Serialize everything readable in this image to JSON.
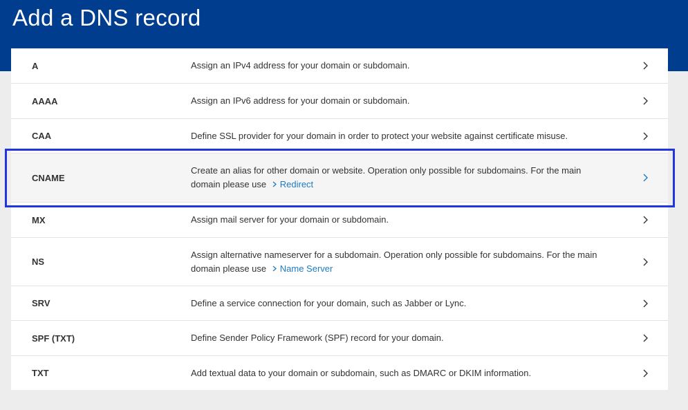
{
  "page": {
    "title": "Add a DNS record"
  },
  "records": [
    {
      "type": "A",
      "description": "Assign an IPv4 address for your domain or subdomain."
    },
    {
      "type": "AAAA",
      "description": "Assign an IPv6 address for your domain or subdomain."
    },
    {
      "type": "CAA",
      "description": "Define SSL provider for your domain in order to protect your website against certificate misuse."
    },
    {
      "type": "CNAME",
      "description": "Create an alias for other domain or website. Operation only possible for subdomains. For the main domain please use",
      "link": "Redirect"
    },
    {
      "type": "MX",
      "description": "Assign mail server for your domain or subdomain."
    },
    {
      "type": "NS",
      "description": "Assign alternative nameserver for a subdomain. Operation only possible for subdomains. For the main domain please use",
      "link": "Name Server"
    },
    {
      "type": "SRV",
      "description": "Define a service connection for your domain, such as Jabber or Lync."
    },
    {
      "type": "SPF (TXT)",
      "description": "Define Sender Policy Framework (SPF) record for your domain."
    },
    {
      "type": "TXT",
      "description": "Add textual data to your domain or subdomain, such as DMARC or DKIM information."
    }
  ],
  "colors": {
    "header": "#003d8f",
    "link": "#1f7bc1",
    "highlight": "#1f35e0"
  },
  "icons": {
    "row_chevron": "chevron-right-icon",
    "link_chevron": "chevron-right-icon"
  }
}
